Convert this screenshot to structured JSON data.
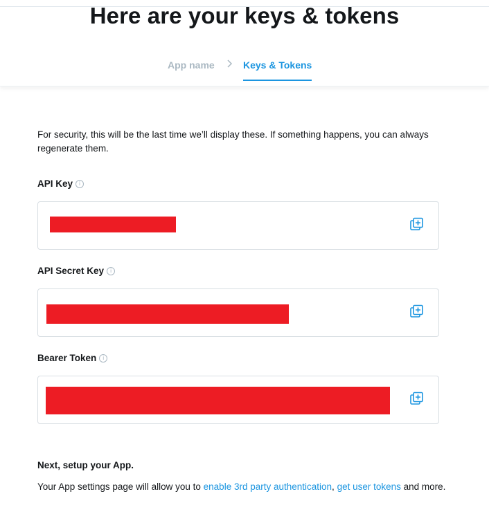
{
  "header": {
    "title": "Here are your keys & tokens",
    "steps": [
      {
        "label": "App name",
        "active": false
      },
      {
        "label": "Keys & Tokens",
        "active": true
      }
    ],
    "separator_icon": "chevron-right-icon"
  },
  "intro_text": "For security, this will be the last time we’ll display these. If something happens, you can always regenerate them.",
  "fields": {
    "api_key": {
      "label": "API Key",
      "value": ""
    },
    "api_secret_key": {
      "label": "API Secret Key",
      "value": ""
    },
    "bearer_token": {
      "label": "Bearer Token",
      "value": ""
    }
  },
  "info_icon": "ⓘ",
  "copy_icon": "copy-icon",
  "next": {
    "title": "Next, setup your App.",
    "text_before": "Your App settings page will allow you to ",
    "link1": "enable 3rd party authentication",
    "sep": ", ",
    "link2": "get user tokens",
    "text_after": " and more."
  },
  "colors": {
    "accent": "#1b95e0",
    "redaction": "#ed1c24",
    "muted": "#aab8c2"
  }
}
